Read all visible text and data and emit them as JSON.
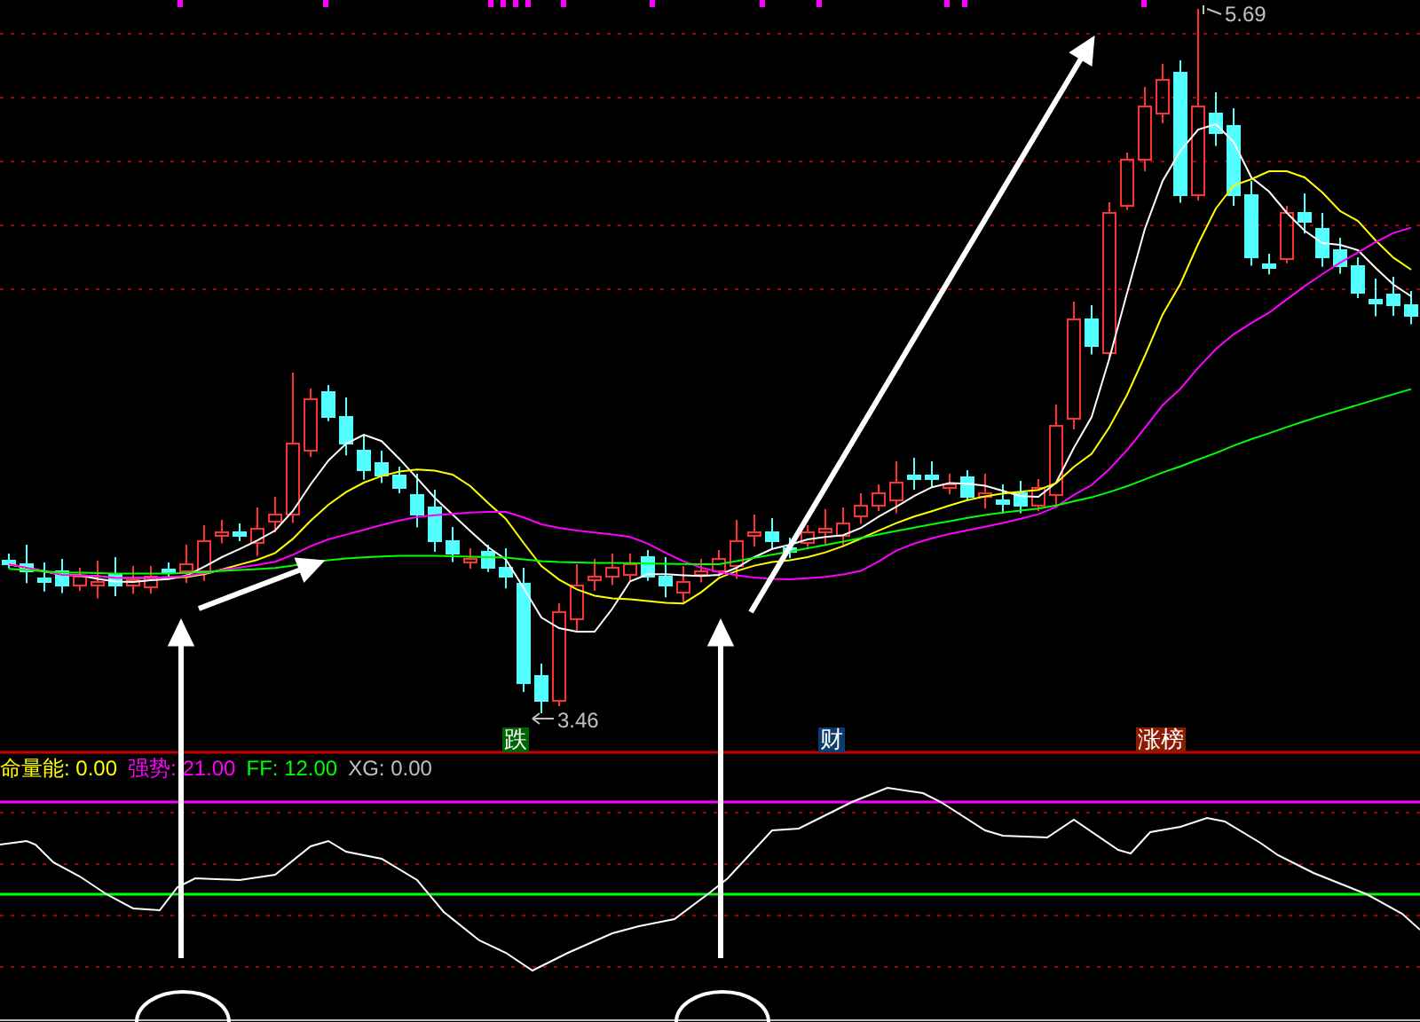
{
  "price_labels": {
    "high": "5.69",
    "low": "3.46"
  },
  "signals": [
    {
      "label": "跌",
      "color": "#006400"
    },
    {
      "label": "财",
      "color": "#0a3d6b"
    },
    {
      "label": "涨榜",
      "color": "#8b1a00"
    }
  ],
  "indicator": [
    {
      "label": "命量能: 0.00",
      "color": "#ffff00"
    },
    {
      "label": "强势: 21.00",
      "color": "#ff00ff"
    },
    {
      "label": "FF: 12.00",
      "color": "#00ff00"
    },
    {
      "label": "XG: 0.00",
      "color": "#c0c0c0"
    }
  ]
}
